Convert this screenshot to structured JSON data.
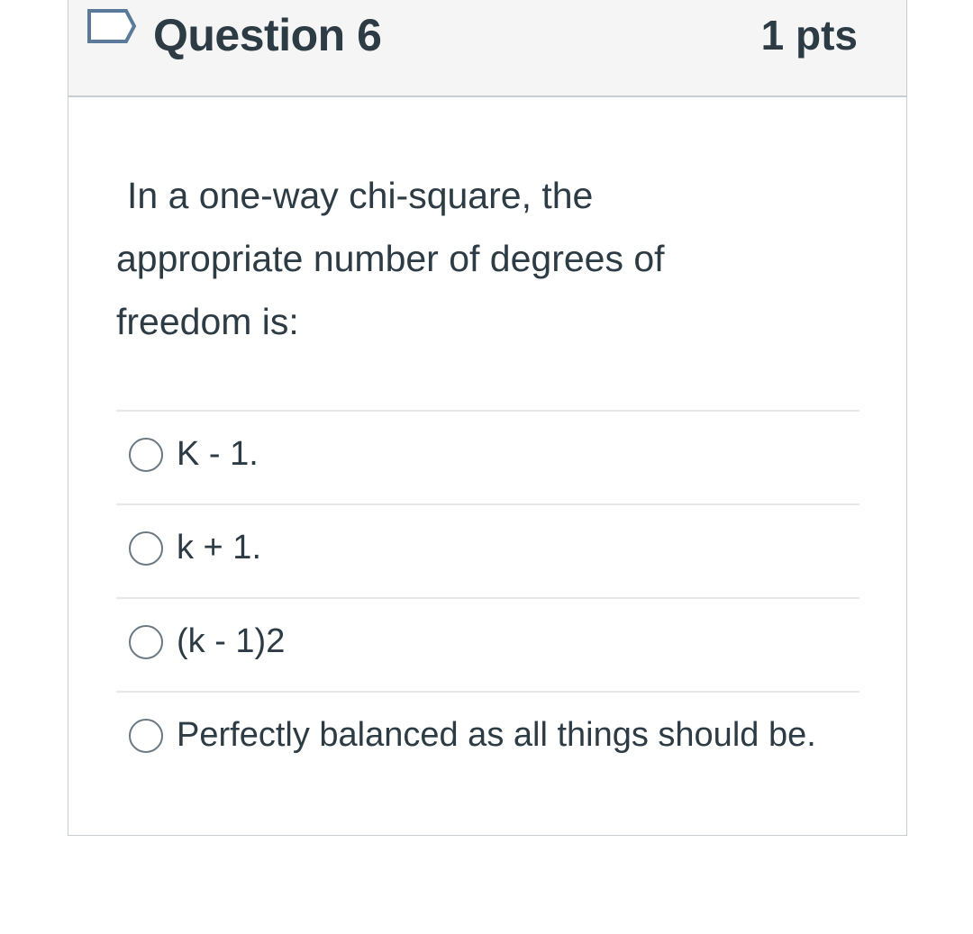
{
  "question": {
    "title": "Question 6",
    "points": "1 pts",
    "text_line1": "In a one-way chi-square, the",
    "text_line2": "appropriate number of degrees of",
    "text_line3": "freedom is:",
    "flag_icon": "flag-question-icon"
  },
  "answers": [
    {
      "label": "K - 1.",
      "selected": false
    },
    {
      "label": "k + 1.",
      "selected": false
    },
    {
      "label": "(k - 1)2",
      "selected": false
    },
    {
      "label": "Perfectly balanced as all things should be.",
      "selected": false
    }
  ],
  "colors": {
    "header_bg": "#f5f5f5",
    "text": "#2d3b45",
    "border": "#c7cdd1",
    "divider": "#e6e9eb",
    "flag_stroke": "#5b7a99"
  }
}
